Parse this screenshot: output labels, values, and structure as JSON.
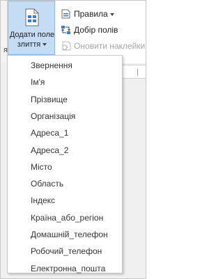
{
  "ribbon": {
    "left_edge_label": "я",
    "merge_button": {
      "label_line1": "Додати поле",
      "label_line2": "злиття",
      "icon": "document-field-icon"
    },
    "commands": [
      {
        "label": "Правила",
        "icon": "rules-icon",
        "has_dropdown": true,
        "enabled": true
      },
      {
        "label": "Добір полів",
        "icon": "match-fields-icon",
        "enabled": true
      },
      {
        "label": "Оновити наклейки",
        "icon": "update-labels-icon",
        "enabled": false
      }
    ]
  },
  "menu": {
    "items": [
      "Звернення",
      "Ім'я",
      "Прізвище",
      "Організація",
      "Адреса_1",
      "Адреса_2",
      "Місто",
      "Область",
      "Індекс",
      "Країна_або_регіон",
      "Домашній_телефон",
      "Робочий_телефон",
      "Електронна_пошта"
    ]
  }
}
